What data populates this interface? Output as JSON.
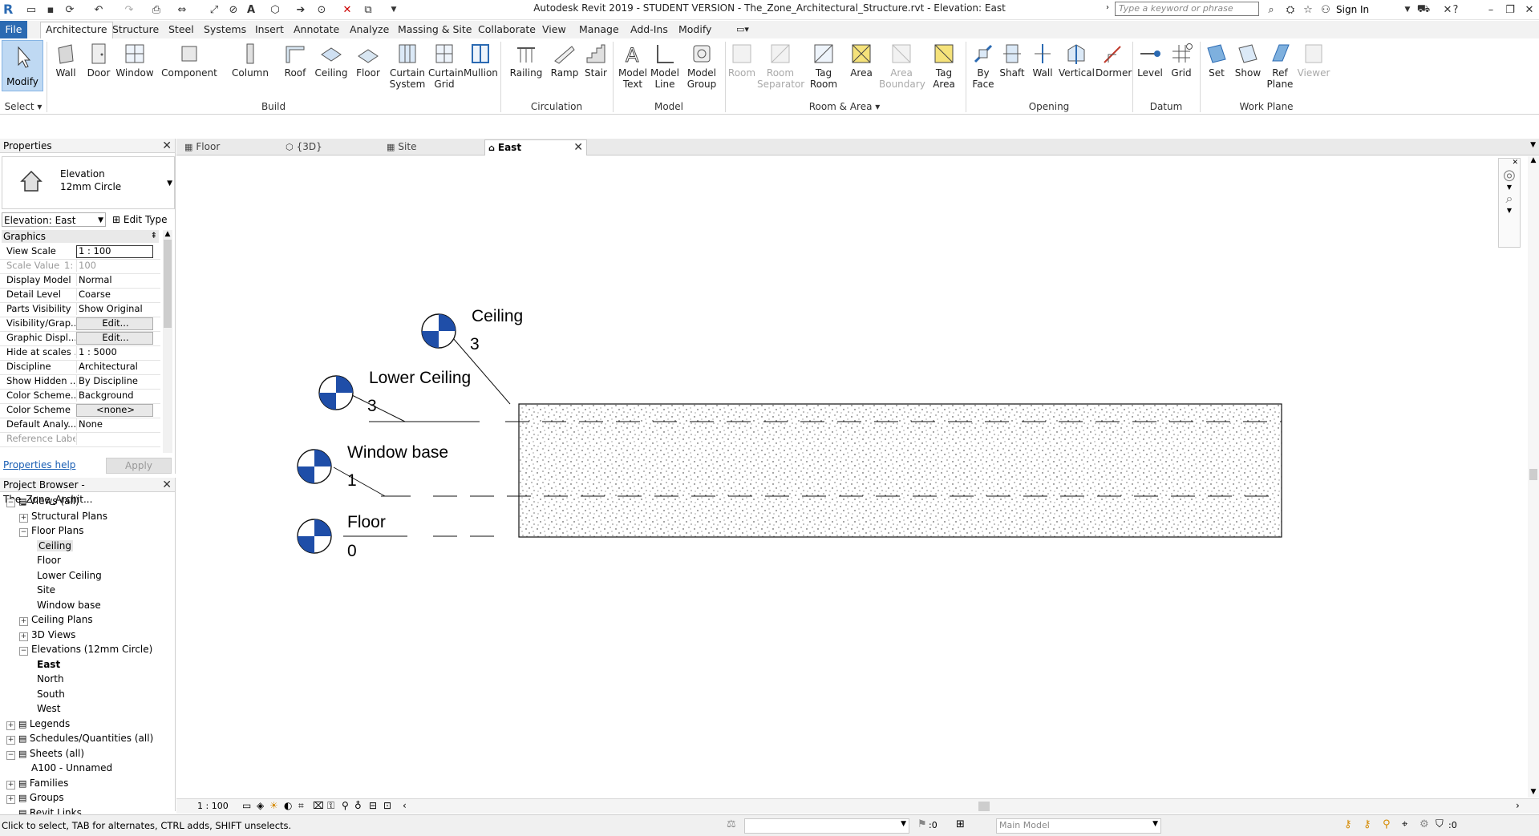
{
  "window": {
    "title": "Autodesk Revit 2019 - STUDENT VERSION - The_Zone_Architectural_Structure.rvt - Elevation: East",
    "search_placeholder": "Type a keyword or phrase",
    "sign_in": "Sign In"
  },
  "ribbon_tabs": [
    "File",
    "Architecture",
    "Structure",
    "Steel",
    "Systems",
    "Insert",
    "Annotate",
    "Analyze",
    "Massing & Site",
    "Collaborate",
    "View",
    "Manage",
    "Add-Ins",
    "Modify"
  ],
  "ribbon": {
    "select": {
      "modify": "Modify",
      "panel": "Select"
    },
    "build": {
      "panel": "Build",
      "buttons": [
        "Wall",
        "Door",
        "Window",
        "Component",
        "Column",
        "Roof",
        "Ceiling",
        "Floor",
        "Curtain System",
        "Curtain Grid",
        "Mullion"
      ]
    },
    "circulation": {
      "panel": "Circulation",
      "buttons": [
        "Railing",
        "Ramp",
        "Stair"
      ]
    },
    "model": {
      "panel": "Model",
      "buttons": [
        "Model Text",
        "Model Line",
        "Model Group"
      ]
    },
    "room_area": {
      "panel": "Room & Area",
      "buttons": [
        "Room",
        "Room Separator",
        "Tag Room",
        "Area",
        "Area Boundary",
        "Tag Area"
      ]
    },
    "opening": {
      "panel": "Opening",
      "buttons": [
        "By Face",
        "Shaft",
        "Wall",
        "Vertical",
        "Dormer"
      ]
    },
    "datum": {
      "panel": "Datum",
      "buttons": [
        "Level",
        "Grid"
      ]
    },
    "work_plane": {
      "panel": "Work Plane",
      "buttons": [
        "Set",
        "Show",
        "Ref Plane",
        "Viewer"
      ]
    }
  },
  "properties": {
    "title": "Properties",
    "type_line1": "Elevation",
    "type_line2": "12mm Circle",
    "instance": "Elevation: East",
    "edit_type": "Edit Type",
    "group": "Graphics",
    "rows": [
      {
        "k": "View Scale",
        "v": "1 : 100"
      },
      {
        "k": "Scale Value",
        "v": "100",
        "extra": "1:"
      },
      {
        "k": "Display Model",
        "v": "Normal"
      },
      {
        "k": "Detail Level",
        "v": "Coarse"
      },
      {
        "k": "Parts Visibility",
        "v": "Show Original"
      },
      {
        "k": "Visibility/Grap...",
        "v": "Edit..."
      },
      {
        "k": "Graphic Displ...",
        "v": "Edit..."
      },
      {
        "k": "Hide at scales ...",
        "v": "1 : 5000"
      },
      {
        "k": "Discipline",
        "v": "Architectural"
      },
      {
        "k": "Show Hidden ...",
        "v": "By Discipline"
      },
      {
        "k": "Color Scheme...",
        "v": "Background"
      },
      {
        "k": "Color Scheme",
        "v": "<none>"
      },
      {
        "k": "Default Analy...",
        "v": "None"
      },
      {
        "k": "Reference Label",
        "v": ""
      }
    ],
    "help": "Properties help",
    "apply": "Apply"
  },
  "browser": {
    "title": "Project Browser - The_Zone_Archit...",
    "items": [
      {
        "label": "Views (all)",
        "level": 0,
        "exp": "−"
      },
      {
        "label": "Structural Plans",
        "level": 1,
        "exp": "+"
      },
      {
        "label": "Floor Plans",
        "level": 1,
        "exp": "−"
      },
      {
        "label": "Ceiling",
        "level": 2,
        "selected": true
      },
      {
        "label": "Floor",
        "level": 2
      },
      {
        "label": "Lower Ceiling",
        "level": 2
      },
      {
        "label": "Site",
        "level": 2
      },
      {
        "label": "Window base",
        "level": 2
      },
      {
        "label": "Ceiling Plans",
        "level": 1,
        "exp": "+"
      },
      {
        "label": "3D Views",
        "level": 1,
        "exp": "+"
      },
      {
        "label": "Elevations (12mm Circle)",
        "level": 1,
        "exp": "−"
      },
      {
        "label": "East",
        "level": 2,
        "bold": true
      },
      {
        "label": "North",
        "level": 2
      },
      {
        "label": "South",
        "level": 2
      },
      {
        "label": "West",
        "level": 2
      },
      {
        "label": "Legends",
        "level": 0,
        "exp": "+"
      },
      {
        "label": "Schedules/Quantities (all)",
        "level": 0,
        "exp": "+"
      },
      {
        "label": "Sheets (all)",
        "level": 0,
        "exp": "−"
      },
      {
        "label": "A100 - Unnamed",
        "level": 1
      },
      {
        "label": "Families",
        "level": 0,
        "exp": "+"
      },
      {
        "label": "Groups",
        "level": 0,
        "exp": "+"
      },
      {
        "label": "Revit Links",
        "level": 0
      }
    ]
  },
  "view_tabs": [
    {
      "label": "Floor"
    },
    {
      "label": "{3D}"
    },
    {
      "label": "Site"
    },
    {
      "label": "East",
      "active": true
    }
  ],
  "levels": [
    {
      "name": "Ceiling",
      "value": "3"
    },
    {
      "name": "Lower Ceiling",
      "value": "3"
    },
    {
      "name": "Window base",
      "value": "1"
    },
    {
      "name": "Floor",
      "value": "0"
    }
  ],
  "view_scale": "1 : 100",
  "status": {
    "text": "Click to select, TAB for alternates, CTRL adds, SHIFT unselects.",
    "model": "Main Model",
    "count1": ":0",
    "count2": ":0"
  },
  "colors": {
    "accent": "#2b6ab2",
    "level_marker": "#1f4ea8"
  }
}
